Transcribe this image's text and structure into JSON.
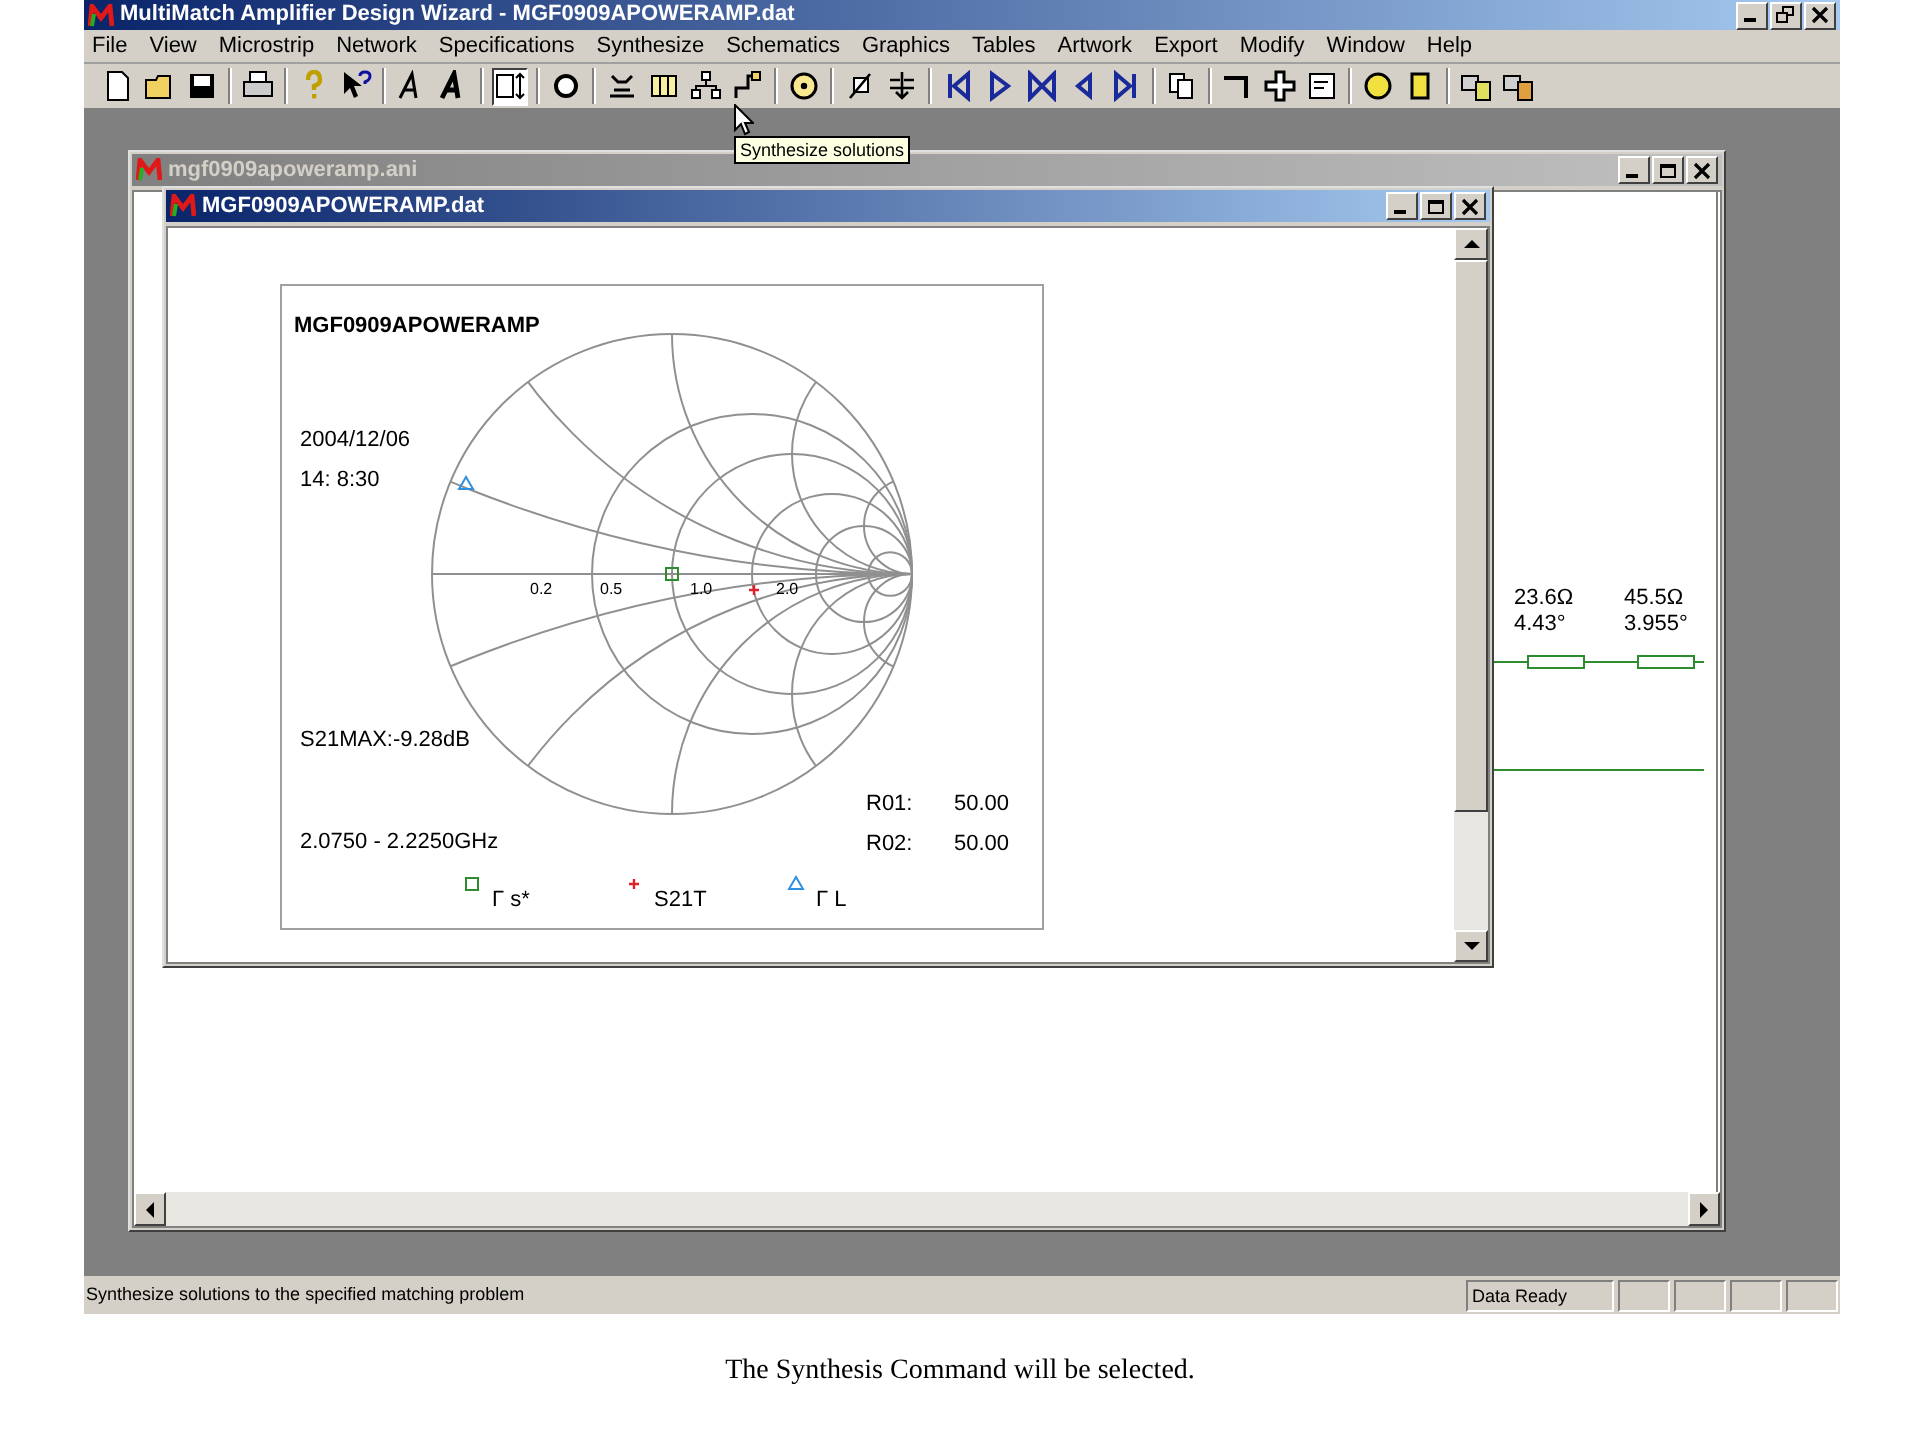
{
  "app": {
    "title": "MultiMatch Amplifier Design Wizard - MGF0909APOWERAMP.dat"
  },
  "menu": [
    "File",
    "View",
    "Microstrip",
    "Network",
    "Specifications",
    "Synthesize",
    "Schematics",
    "Graphics",
    "Tables",
    "Artwork",
    "Export",
    "Modify",
    "Window",
    "Help"
  ],
  "toolbar": [
    {
      "kind": "new",
      "pressed": false
    },
    {
      "kind": "open",
      "pressed": false
    },
    {
      "kind": "save",
      "pressed": false
    },
    {
      "kind": "separator"
    },
    {
      "kind": "print",
      "pressed": false
    },
    {
      "kind": "separator"
    },
    {
      "kind": "help",
      "pressed": false
    },
    {
      "kind": "whats-this",
      "pressed": false
    },
    {
      "kind": "separator"
    },
    {
      "kind": "font",
      "pressed": false
    },
    {
      "kind": "font-bold",
      "pressed": false
    },
    {
      "kind": "separator"
    },
    {
      "kind": "fit",
      "pressed": true
    },
    {
      "kind": "separator"
    },
    {
      "kind": "ring",
      "pressed": false
    },
    {
      "kind": "separator"
    },
    {
      "kind": "stub",
      "pressed": false
    },
    {
      "kind": "columns",
      "pressed": false
    },
    {
      "kind": "tree",
      "pressed": false
    },
    {
      "kind": "step",
      "pressed": false
    },
    {
      "kind": "separator"
    },
    {
      "kind": "synthesize",
      "pressed": false
    },
    {
      "kind": "separator"
    },
    {
      "kind": "probe",
      "pressed": false
    },
    {
      "kind": "tune",
      "pressed": false
    },
    {
      "kind": "separator"
    },
    {
      "kind": "first",
      "pressed": false
    },
    {
      "kind": "play",
      "pressed": false
    },
    {
      "kind": "bowtie",
      "pressed": false
    },
    {
      "kind": "back",
      "pressed": false
    },
    {
      "kind": "last",
      "pressed": false
    },
    {
      "kind": "separator"
    },
    {
      "kind": "copy",
      "pressed": false
    },
    {
      "kind": "separator"
    },
    {
      "kind": "pipe",
      "pressed": false
    },
    {
      "kind": "cross",
      "pressed": false
    },
    {
      "kind": "list",
      "pressed": false
    },
    {
      "kind": "separator"
    },
    {
      "kind": "yellow-circle",
      "pressed": false
    },
    {
      "kind": "yellow-rect",
      "pressed": false
    },
    {
      "kind": "separator"
    },
    {
      "kind": "library",
      "pressed": false
    },
    {
      "kind": "library-alt",
      "pressed": false
    }
  ],
  "tooltip": "Synthesize solutions",
  "schematic_window": {
    "title": "mgf0909apoweramp.ani",
    "active": false,
    "elements": [
      {
        "impedance": "23.6Ω",
        "length": "4.43°"
      },
      {
        "impedance": "45.5Ω",
        "length": "3.955°"
      }
    ]
  },
  "chart_window": {
    "title": "MGF0909APOWERAMP.dat",
    "active": true
  },
  "smith_chart": {
    "title": "MGF0909APOWERAMP",
    "date": "2004/12/06",
    "time": "14: 8:30",
    "axis_labels": [
      "0.2",
      "0.5",
      "1.0",
      "2.0"
    ],
    "s21max": "S21MAX:-9.28dB",
    "frequency_range": "2.0750 - 2.2250GHz",
    "ports": [
      {
        "label": "R01:",
        "value": "50.00"
      },
      {
        "label": "R02:",
        "value": "50.00"
      }
    ],
    "legend": [
      {
        "label": "Γ s*",
        "kind": "square",
        "color": "#2e8b2e"
      },
      {
        "label": "S21T",
        "kind": "plus",
        "color": "#e0202a"
      },
      {
        "label": "Γ L",
        "kind": "triangle",
        "color": "#2f8fe0"
      }
    ]
  },
  "status_bar": {
    "message": "Synthesize solutions to the specified matching problem",
    "panels": [
      "Data Ready"
    ]
  },
  "caption": "The Synthesis Command will be selected."
}
